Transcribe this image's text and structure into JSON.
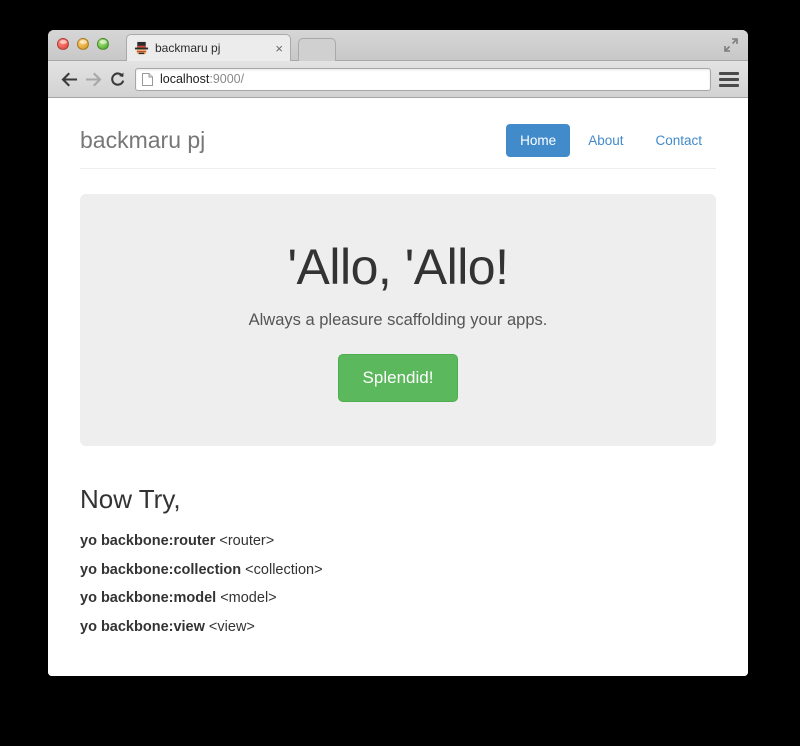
{
  "browser": {
    "traffic_lights": [
      "close",
      "minimize",
      "maximize"
    ],
    "fullscreen_icon": "fullscreen-expand-icon",
    "tab": {
      "favicon": "yeoman-hat-favicon",
      "title": "backmaru pj",
      "close_label": "×"
    },
    "new_tab_label": "",
    "toolbar": {
      "back_icon": "arrow-left-icon",
      "forward_icon": "arrow-right-icon",
      "reload_icon": "reload-icon",
      "page_icon": "page-document-icon",
      "url_host": "localhost",
      "url_rest": ":9000/",
      "menu_icon": "hamburger-menu-icon"
    }
  },
  "page": {
    "brand": "backmaru pj",
    "nav": [
      {
        "label": "Home",
        "active": true
      },
      {
        "label": "About",
        "active": false
      },
      {
        "label": "Contact",
        "active": false
      }
    ],
    "jumbotron": {
      "title": "'Allo, 'Allo!",
      "subtitle": "Always a pleasure scaffolding your apps.",
      "button_label": "Splendid!"
    },
    "now_try": {
      "heading": "Now Try,",
      "commands": [
        {
          "cmd": "yo backbone:router",
          "arg": " <router>"
        },
        {
          "cmd": "yo backbone:collection",
          "arg": " <collection>"
        },
        {
          "cmd": "yo backbone:model",
          "arg": " <model>"
        },
        {
          "cmd": "yo backbone:view",
          "arg": " <view>"
        }
      ]
    }
  },
  "colors": {
    "primary": "#428bca",
    "success": "#5cb85c",
    "jumbotron_bg": "#eeeeee",
    "brand_text": "#777777",
    "body_text": "#333333"
  }
}
